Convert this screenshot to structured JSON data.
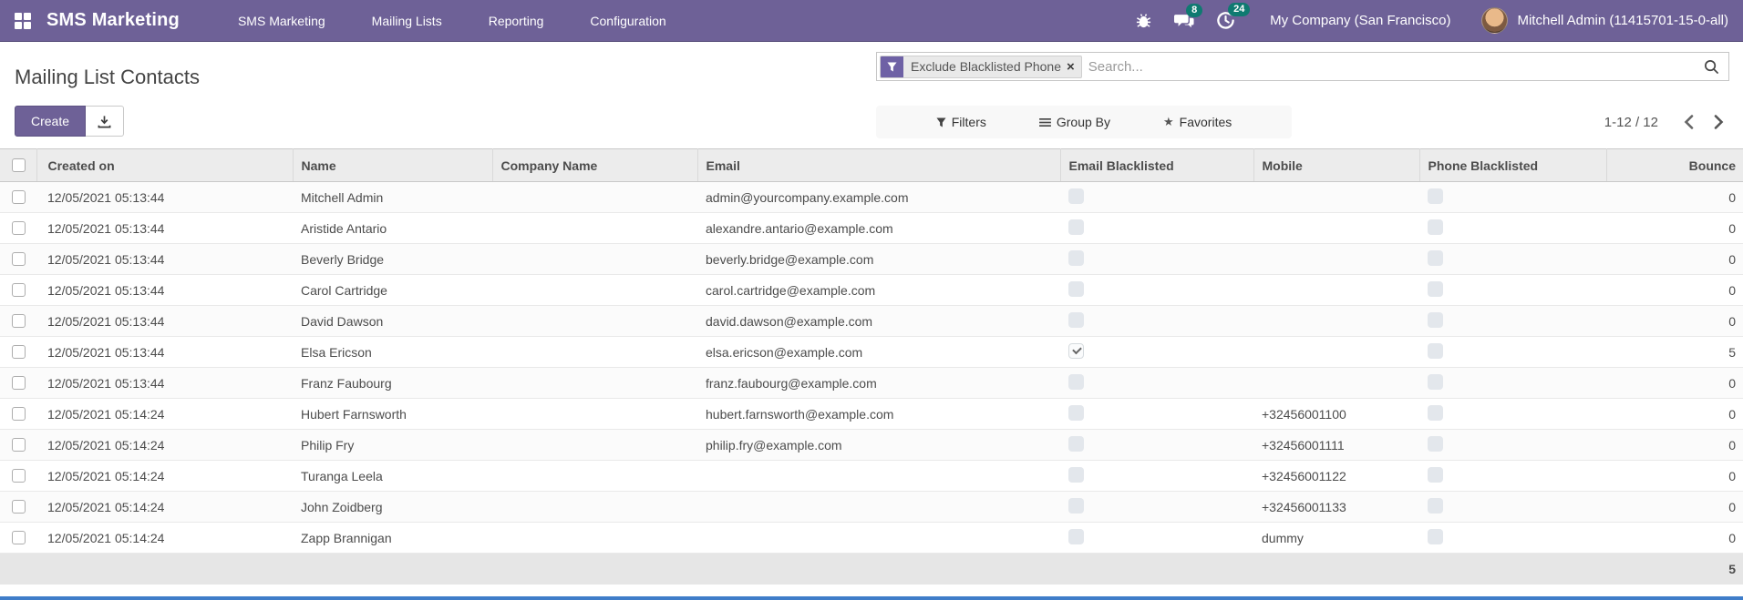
{
  "colors": {
    "primary": "#6e6197",
    "primary_dark": "#5d5282",
    "badge": "#0f7a71",
    "facet_icon": "#6e61a5",
    "bottom_line": "#3f7dc9"
  },
  "navbar": {
    "brand": "SMS Marketing",
    "menus": [
      "SMS Marketing",
      "Mailing Lists",
      "Reporting",
      "Configuration"
    ],
    "systray": {
      "messages_count": "8",
      "activities_count": "24",
      "company": "My Company (San Francisco)",
      "user": "Mitchell Admin (11415701-15-0-all)"
    }
  },
  "control_panel": {
    "title": "Mailing List Contacts",
    "create_label": "Create",
    "search": {
      "facet_label": "Exclude Blacklisted Phone",
      "placeholder": "Search..."
    },
    "filters_label": "Filters",
    "group_by_label": "Group By",
    "favorites_label": "Favorites",
    "pager_text": "1-12 / 12"
  },
  "table": {
    "columns": [
      "Created on",
      "Name",
      "Company Name",
      "Email",
      "Email Blacklisted",
      "Mobile",
      "Phone Blacklisted",
      "Bounce"
    ],
    "rows": [
      {
        "created_on": "12/05/2021 05:13:44",
        "name": "Mitchell Admin",
        "company": "",
        "email": "admin@yourcompany.example.com",
        "email_blacklisted": false,
        "mobile": "",
        "phone_blacklisted": false,
        "bounce": "0"
      },
      {
        "created_on": "12/05/2021 05:13:44",
        "name": "Aristide Antario",
        "company": "",
        "email": "alexandre.antario@example.com",
        "email_blacklisted": false,
        "mobile": "",
        "phone_blacklisted": false,
        "bounce": "0"
      },
      {
        "created_on": "12/05/2021 05:13:44",
        "name": "Beverly Bridge",
        "company": "",
        "email": "beverly.bridge@example.com",
        "email_blacklisted": false,
        "mobile": "",
        "phone_blacklisted": false,
        "bounce": "0"
      },
      {
        "created_on": "12/05/2021 05:13:44",
        "name": "Carol Cartridge",
        "company": "",
        "email": "carol.cartridge@example.com",
        "email_blacklisted": false,
        "mobile": "",
        "phone_blacklisted": false,
        "bounce": "0"
      },
      {
        "created_on": "12/05/2021 05:13:44",
        "name": "David Dawson",
        "company": "",
        "email": "david.dawson@example.com",
        "email_blacklisted": false,
        "mobile": "",
        "phone_blacklisted": false,
        "bounce": "0"
      },
      {
        "created_on": "12/05/2021 05:13:44",
        "name": "Elsa Ericson",
        "company": "",
        "email": "elsa.ericson@example.com",
        "email_blacklisted": true,
        "mobile": "",
        "phone_blacklisted": false,
        "bounce": "5"
      },
      {
        "created_on": "12/05/2021 05:13:44",
        "name": "Franz Faubourg",
        "company": "",
        "email": "franz.faubourg@example.com",
        "email_blacklisted": false,
        "mobile": "",
        "phone_blacklisted": false,
        "bounce": "0"
      },
      {
        "created_on": "12/05/2021 05:14:24",
        "name": "Hubert Farnsworth",
        "company": "",
        "email": "hubert.farnsworth@example.com",
        "email_blacklisted": false,
        "mobile": "+32456001100",
        "phone_blacklisted": false,
        "bounce": "0"
      },
      {
        "created_on": "12/05/2021 05:14:24",
        "name": "Philip Fry",
        "company": "",
        "email": "philip.fry@example.com",
        "email_blacklisted": false,
        "mobile": "+32456001111",
        "phone_blacklisted": false,
        "bounce": "0"
      },
      {
        "created_on": "12/05/2021 05:14:24",
        "name": "Turanga Leela",
        "company": "",
        "email": "",
        "email_blacklisted": false,
        "mobile": "+32456001122",
        "phone_blacklisted": false,
        "bounce": "0"
      },
      {
        "created_on": "12/05/2021 05:14:24",
        "name": "John Zoidberg",
        "company": "",
        "email": "",
        "email_blacklisted": false,
        "mobile": "+32456001133",
        "phone_blacklisted": false,
        "bounce": "0"
      },
      {
        "created_on": "12/05/2021 05:14:24",
        "name": "Zapp Brannigan",
        "company": "",
        "email": "",
        "email_blacklisted": false,
        "mobile": "dummy",
        "phone_blacklisted": false,
        "bounce": "0"
      }
    ],
    "footer": {
      "bounce_total": "5"
    }
  }
}
